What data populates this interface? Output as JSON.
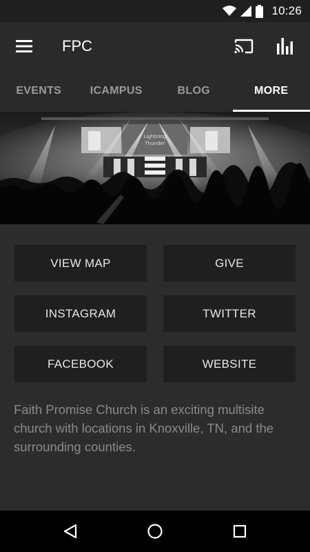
{
  "status_bar": {
    "time": "10:26",
    "icons": [
      "wifi-icon",
      "signal-icon",
      "battery-icon"
    ]
  },
  "app_bar": {
    "title": "FPC",
    "menu_icon": "hamburger-menu-icon",
    "actions": [
      "cast-icon",
      "bar-chart-icon"
    ]
  },
  "tabs": [
    {
      "label": "EVENTS",
      "active": false
    },
    {
      "label": "ICAMPUS",
      "active": false
    },
    {
      "label": "BLOG",
      "active": false
    },
    {
      "label": "MORE",
      "active": true
    }
  ],
  "hero": {
    "screen_text_line1": "Lightning",
    "screen_text_line2": "Thunder"
  },
  "buttons": {
    "view_map": "VIEW MAP",
    "give": "GIVE",
    "instagram": "INSTAGRAM",
    "twitter": "TWITTER",
    "facebook": "FACEBOOK",
    "website": "WEBSITE"
  },
  "description": "Faith Promise Church is an exciting multisite church with locations in Knoxville, TN, and the surrounding counties.",
  "nav_bar": {
    "icons": [
      "back-icon",
      "home-icon",
      "recents-icon"
    ]
  },
  "colors": {
    "status_bar": "#1f1f1f",
    "app_bar": "#2a2a2a",
    "background": "#2c2c2c",
    "button": "#1f1f1f",
    "tab_active": "#ffffff",
    "tab_inactive": "#9a9a9a",
    "description_text": "#8a8a8a"
  }
}
